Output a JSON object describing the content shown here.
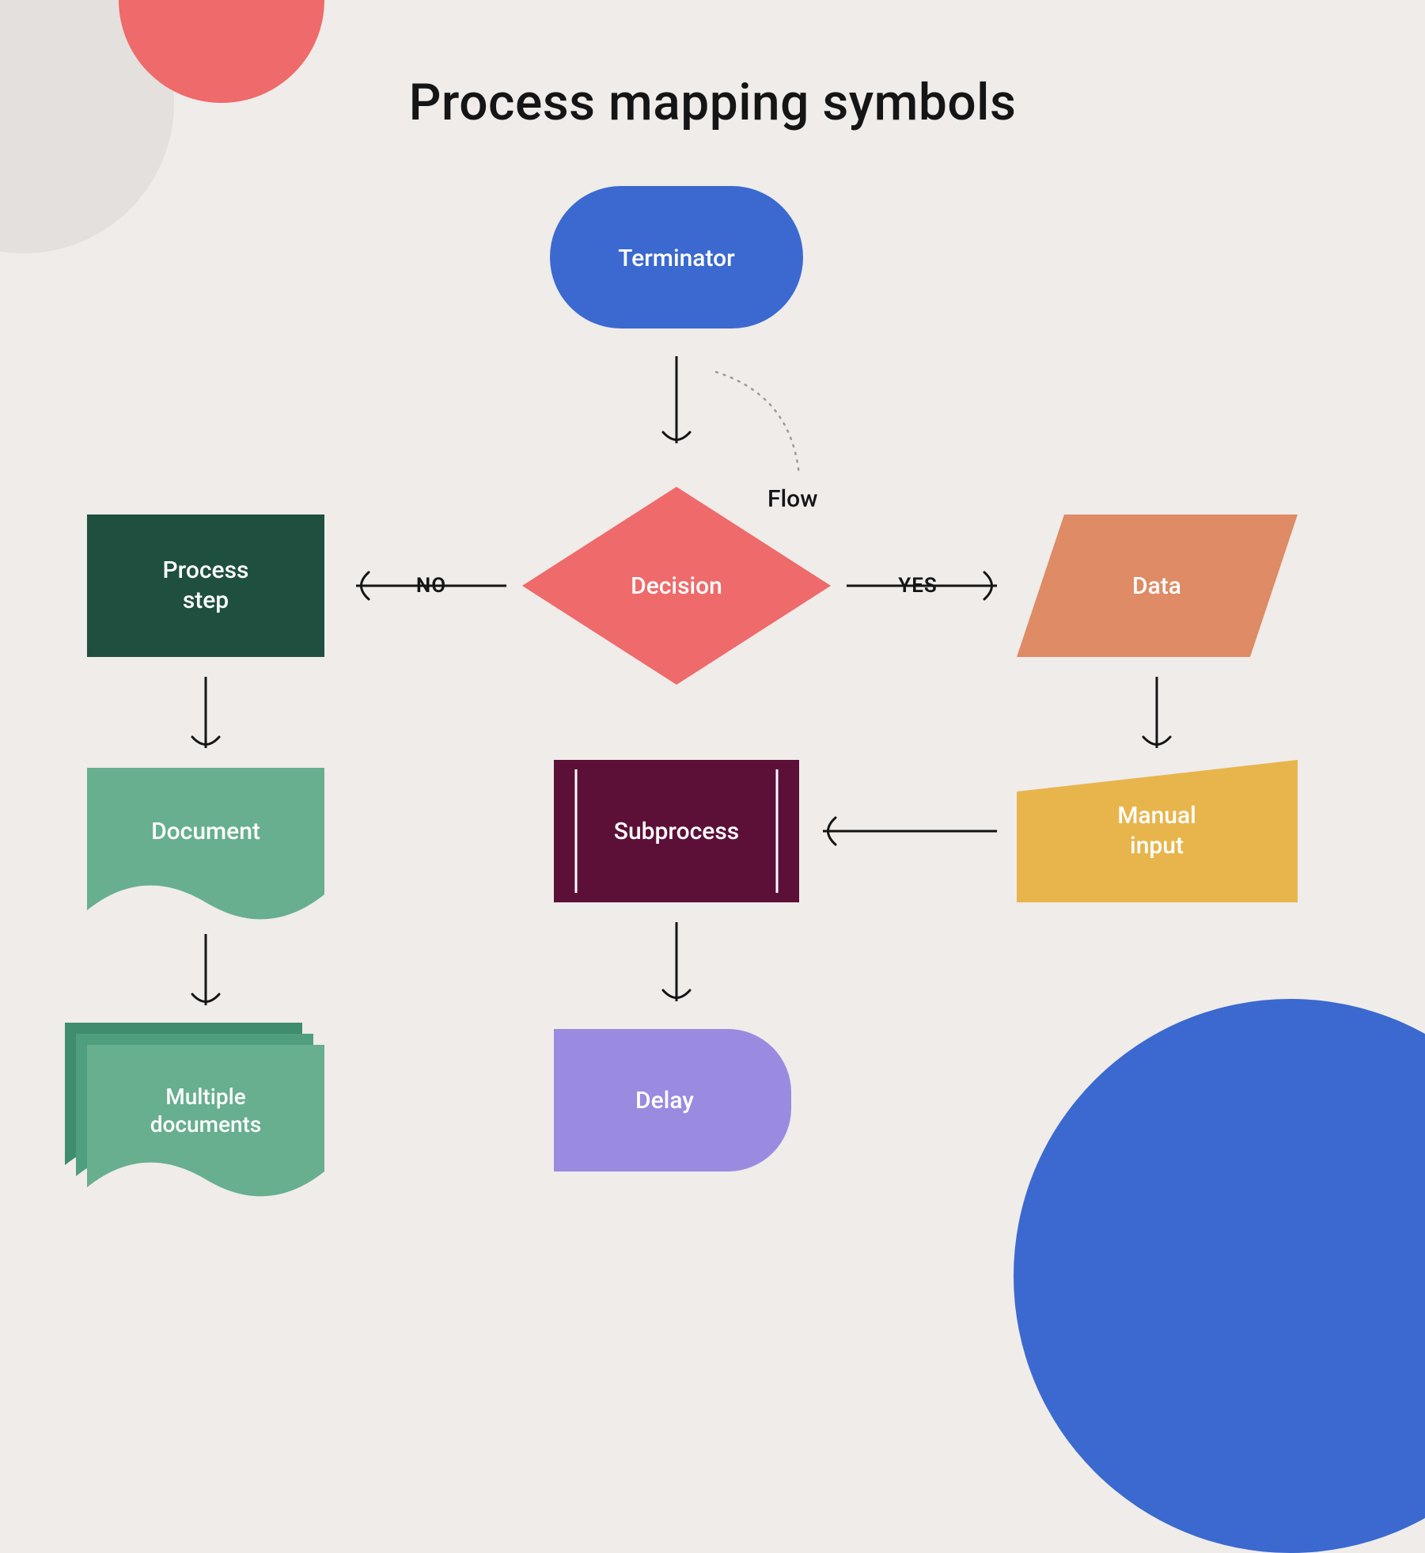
{
  "title": "Process mapping symbols",
  "shapes": {
    "terminator": {
      "label": "Terminator",
      "color": "#3b69cf"
    },
    "decision": {
      "label": "Decision",
      "color": "#ef6a6a"
    },
    "process_step": {
      "label_line1": "Process",
      "label_line2": "step",
      "color": "#1f4f3f"
    },
    "data": {
      "label": "Data",
      "color": "#de8b66"
    },
    "document": {
      "label": "Document",
      "color": "#67af8e"
    },
    "manual_input": {
      "label_line1": "Manual",
      "label_line2": "input",
      "color": "#e8b54d"
    },
    "subprocess": {
      "label": "Subprocess",
      "color": "#5c1038"
    },
    "multiple_documents": {
      "label_line1": "Multiple",
      "label_line2": "documents",
      "color": "#67af8e",
      "stack": "#3f8d6e"
    },
    "delay": {
      "label": "Delay",
      "color": "#9a8be0"
    }
  },
  "edges": {
    "no": "NO",
    "yes": "YES",
    "flow": "Flow"
  }
}
